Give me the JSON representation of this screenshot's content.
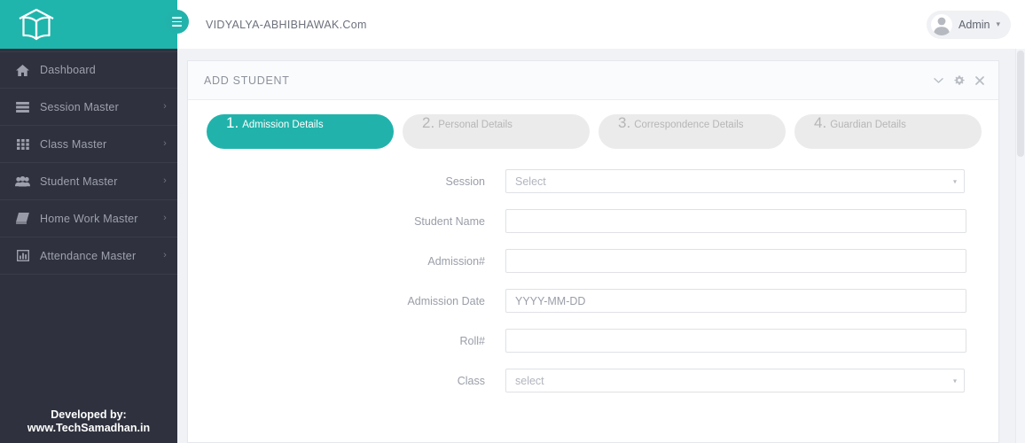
{
  "colors": {
    "teal": "#1fb5ac",
    "sidebar_dark": "#2f323e",
    "page_bg": "#f1f2f6",
    "muted_text": "#9a9ea8",
    "step_inactive_bg": "#ebebeb"
  },
  "sidebar": {
    "logo_icon": "school-book-logo-icon",
    "items": [
      {
        "label": "Dashboard",
        "icon": "home-icon",
        "has_caret": false,
        "caret": "›"
      },
      {
        "label": "Session Master",
        "icon": "list-icon",
        "has_caret": true,
        "caret": "›"
      },
      {
        "label": "Class Master",
        "icon": "grid-icon",
        "has_caret": true,
        "caret": "›"
      },
      {
        "label": "Student Master",
        "icon": "users-icon",
        "has_caret": true,
        "caret": "›"
      },
      {
        "label": "Home Work Master",
        "icon": "book-icon",
        "has_caret": true,
        "caret": "›"
      },
      {
        "label": "Attendance Master",
        "icon": "bar-chart-icon",
        "has_caret": true,
        "caret": "›"
      }
    ],
    "footer": {
      "line1": "Developed by:",
      "line2": "www.TechSamadhan.in"
    }
  },
  "topbar": {
    "menu_toggle_icon": "hamburger-icon",
    "brand_title": "VIDYALYA-ABHIBHAWAK.Com",
    "admin": {
      "name": "Admin",
      "avatar_icon": "user-avatar-icon",
      "caret": "▾"
    }
  },
  "card": {
    "title": "ADD STUDENT",
    "tools": [
      {
        "name": "collapse-icon",
        "glyph": "⌄"
      },
      {
        "name": "settings-gear-icon",
        "glyph": "⚙"
      },
      {
        "name": "close-icon",
        "glyph": "✕"
      }
    ],
    "steps": [
      {
        "num": "1.",
        "label": "Admission Details",
        "active": true
      },
      {
        "num": "2.",
        "label": "Personal Details",
        "active": false
      },
      {
        "num": "3.",
        "label": "Correspondence Details",
        "active": false
      },
      {
        "num": "4.",
        "label": "Guardian Details",
        "active": false
      }
    ],
    "form": {
      "fields": [
        {
          "label": "Session",
          "type": "select",
          "value": "Select",
          "caret": "▾"
        },
        {
          "label": "Student Name",
          "type": "text",
          "value": ""
        },
        {
          "label": "Admission#",
          "type": "text",
          "value": ""
        },
        {
          "label": "Admission Date",
          "type": "text",
          "value": "YYYY-MM-DD"
        },
        {
          "label": "Roll#",
          "type": "text",
          "value": ""
        },
        {
          "label": "Class",
          "type": "select",
          "value": "select",
          "caret": "▾"
        }
      ]
    }
  }
}
